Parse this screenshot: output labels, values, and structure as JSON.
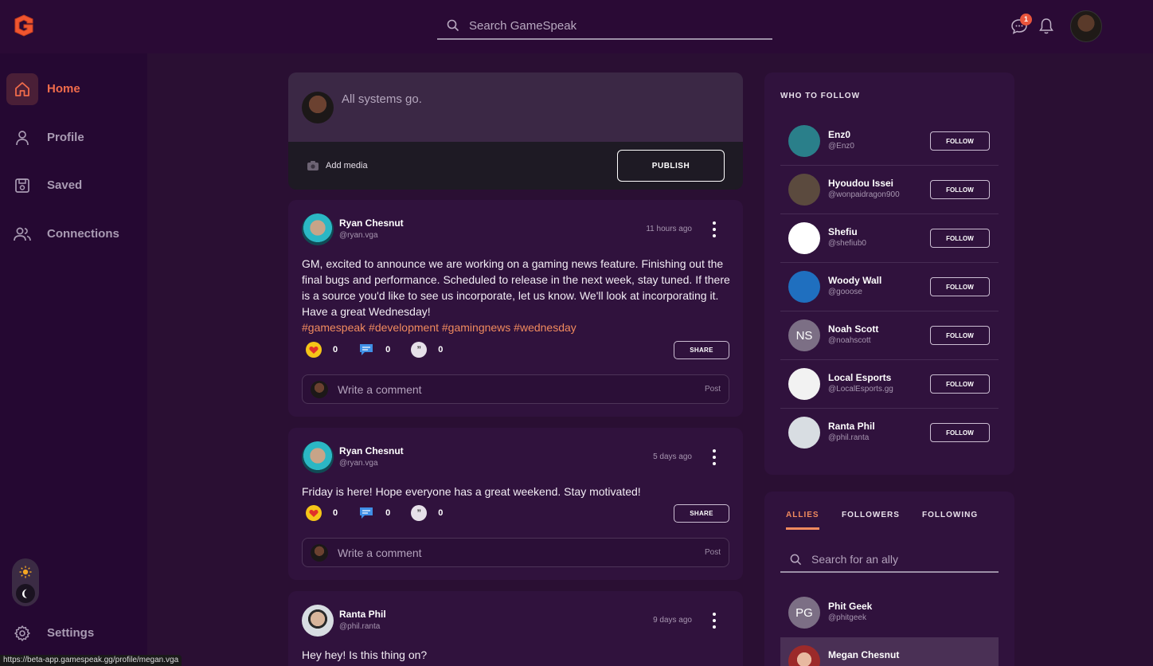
{
  "app": {
    "name": "GameSpeak"
  },
  "header": {
    "search_placeholder": "Search GameSpeak",
    "messages_badge": "1"
  },
  "sidebar": {
    "items": [
      {
        "label": "Home",
        "icon": "home-icon",
        "active": true
      },
      {
        "label": "Profile",
        "icon": "user-icon"
      },
      {
        "label": "Saved",
        "icon": "save-icon"
      },
      {
        "label": "Connections",
        "icon": "users-icon"
      }
    ],
    "settings_label": "Settings"
  },
  "status_url": "https://beta-app.gamespeak.gg/profile/megan.vga",
  "composer": {
    "text": "All systems go.",
    "add_media": "Add media",
    "publish": "PUBLISH"
  },
  "posts": [
    {
      "name": "Ryan Chesnut",
      "handle": "@ryan.vga",
      "time": "11 hours ago",
      "body": "GM, excited to announce we are working on a gaming news feature. Finishing out the final bugs and performance. Scheduled to release in the next week, stay tuned. If there is a source you'd like to see us incorporate, let us know. We'll look at incorporating it. Have a great Wednesday!",
      "tags": "#gamespeak #development #gamingnews #wednesday",
      "likes": "0",
      "comments": "0",
      "quotes": "0",
      "share": "SHARE",
      "comment_placeholder": "Write a comment",
      "comment_post": "Post"
    },
    {
      "name": "Ryan Chesnut",
      "handle": "@ryan.vga",
      "time": "5 days ago",
      "body": "Friday is here! Hope everyone has a great weekend. Stay motivated!",
      "likes": "0",
      "comments": "0",
      "quotes": "0",
      "share": "SHARE",
      "comment_placeholder": "Write a comment",
      "comment_post": "Post"
    },
    {
      "name": "Ranta Phil",
      "handle": "@phil.ranta",
      "time": "9 days ago",
      "body": "Hey hey! Is this thing on?"
    }
  ],
  "who_to_follow": {
    "title": "WHO TO FOLLOW",
    "button": "FOLLOW",
    "users": [
      {
        "name": "Enz0",
        "handle": "@Enz0",
        "color": "#2a7f8a"
      },
      {
        "name": "Hyoudou Issei",
        "handle": "@wonpaidragon900",
        "color": "#5b4a3e"
      },
      {
        "name": "Shefiu",
        "handle": "@shefiub0",
        "color": "#ffffff"
      },
      {
        "name": "Woody Wall",
        "handle": "@gooose",
        "color": "#1f6fbf"
      },
      {
        "name": "Noah Scott",
        "handle": "@noahscott",
        "initials": "NS",
        "color": "#7c6f85"
      },
      {
        "name": "Local Esports",
        "handle": "@LocalEsports.gg",
        "color": "#f2f2f2"
      },
      {
        "name": "Ranta Phil",
        "handle": "@phil.ranta",
        "color": "#d8dde2"
      }
    ]
  },
  "allies": {
    "tabs": [
      "ALLIES",
      "FOLLOWERS",
      "FOLLOWING"
    ],
    "search_placeholder": "Search for an ally",
    "list": [
      {
        "name": "Phit Geek",
        "handle": "@phitgeek",
        "initials": "PG"
      },
      {
        "name": "Megan Chesnut",
        "handle": ""
      }
    ]
  },
  "colors": {
    "accent": "#f06b4b",
    "background": "#2a0f33",
    "card": "#30123d"
  }
}
